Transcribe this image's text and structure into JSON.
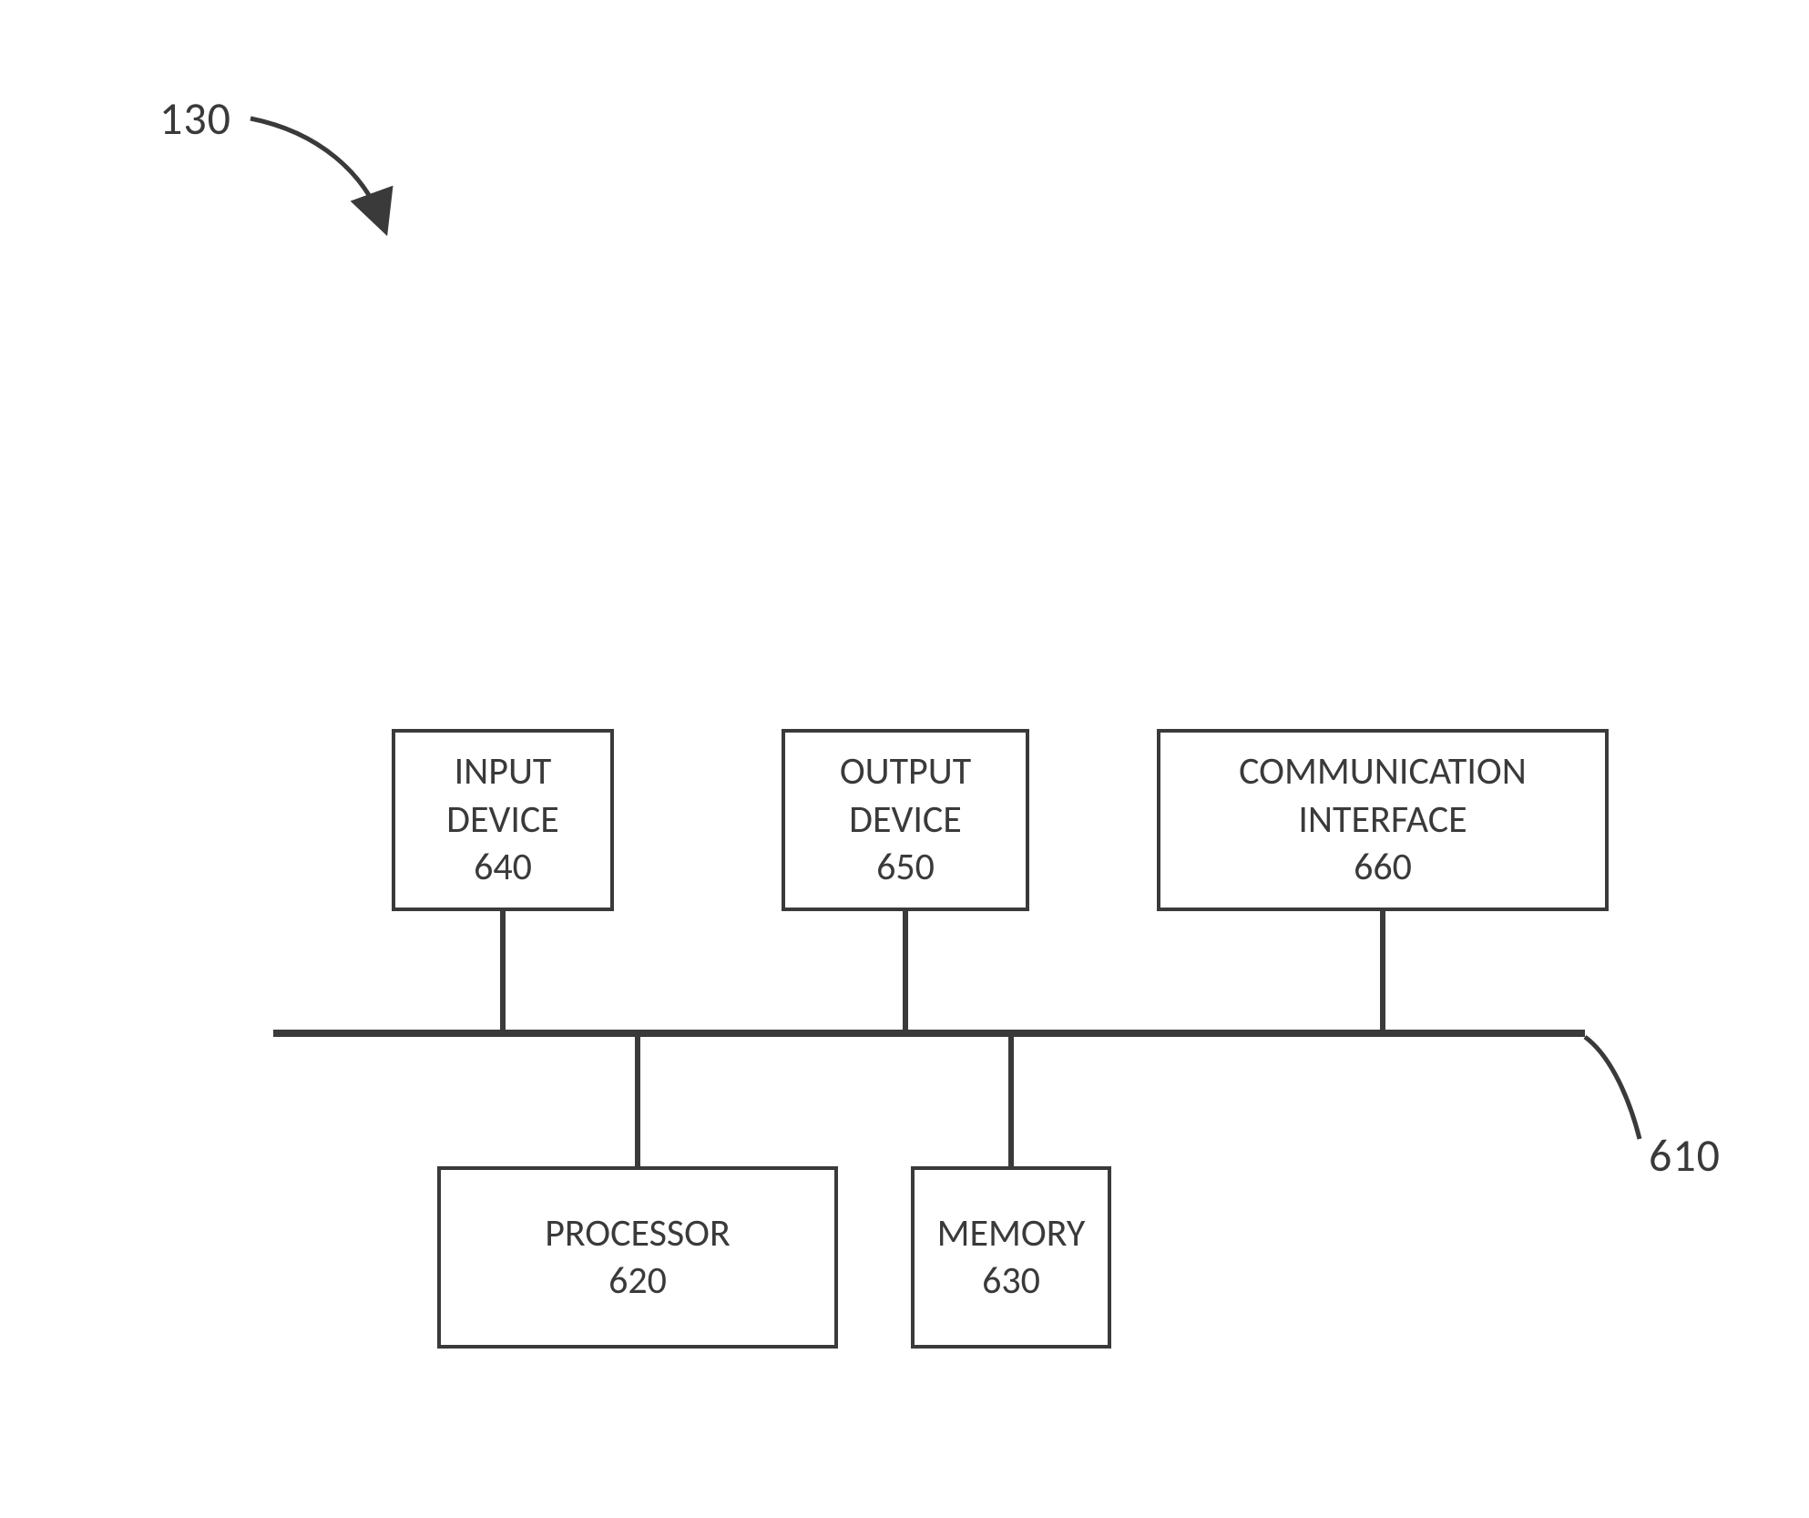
{
  "figure_ref": "130",
  "bus_ref": "610",
  "blocks": {
    "input": {
      "title": "INPUT DEVICE",
      "num": "640"
    },
    "output": {
      "title": "OUTPUT DEVICE",
      "num": "650"
    },
    "comm": {
      "title": "COMMUNICATION INTERFACE",
      "num": "660"
    },
    "processor": {
      "title": "PROCESSOR",
      "num": "620"
    },
    "memory": {
      "title": "MEMORY",
      "num": "630"
    }
  }
}
